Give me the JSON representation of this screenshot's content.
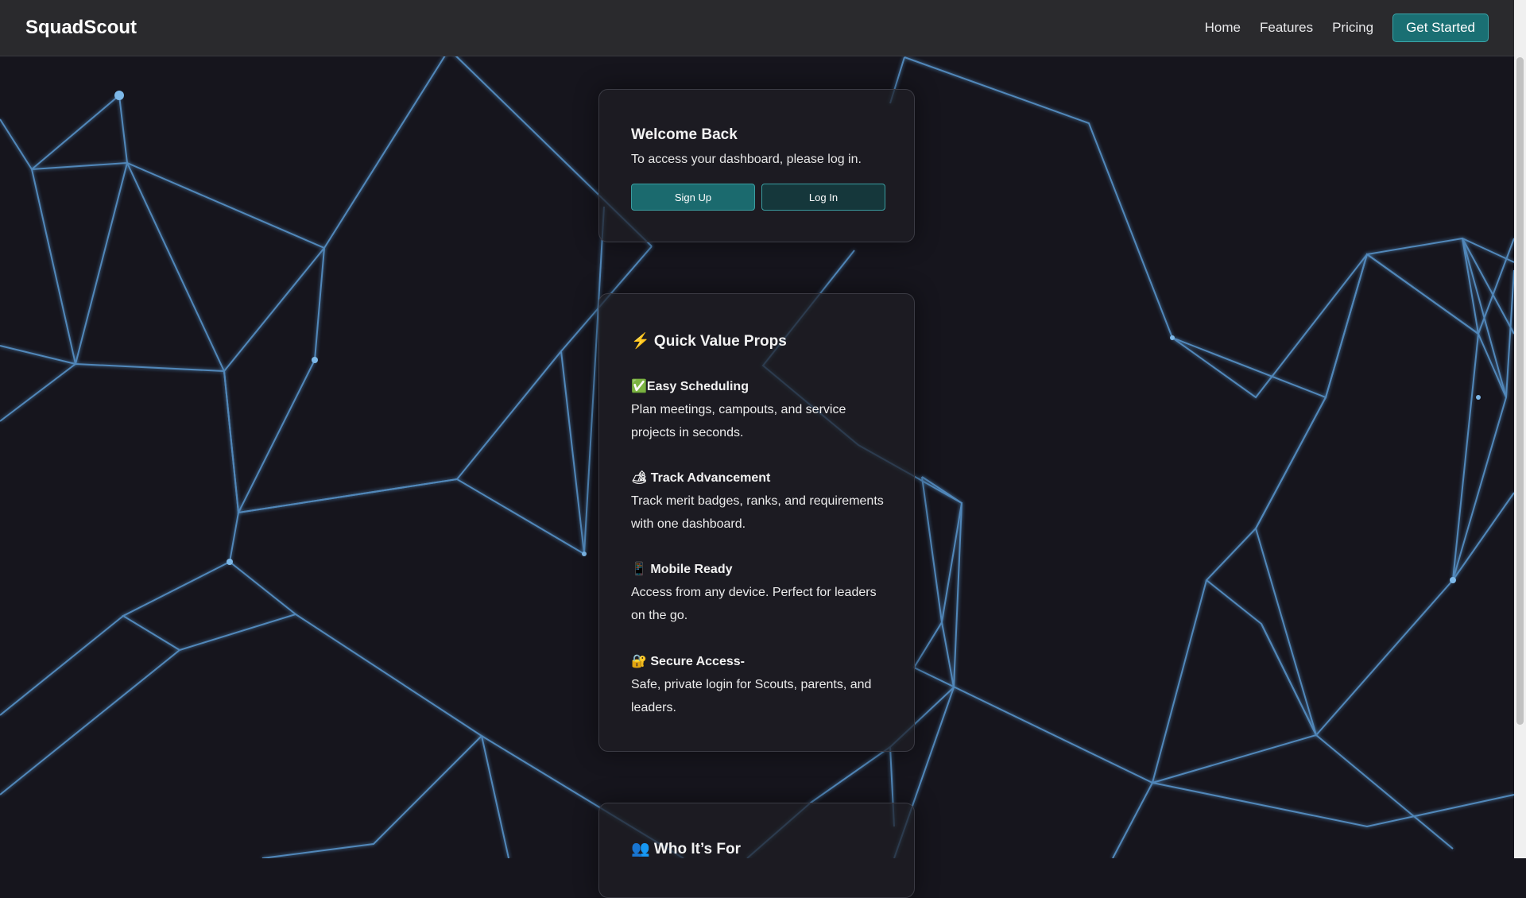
{
  "brand": "SquadScout",
  "nav": {
    "links": [
      "Home",
      "Features",
      "Pricing"
    ],
    "cta": "Get Started"
  },
  "welcome": {
    "title": "Welcome Back",
    "subtitle": "To access your dashboard, please log in.",
    "signup_label": "Sign Up",
    "login_label": "Log In"
  },
  "value_props": {
    "title": "⚡ Quick Value Props",
    "items": [
      {
        "title": "✅Easy Scheduling",
        "text": "Plan meetings, campouts, and service projects in seconds."
      },
      {
        "title": "🏕 Track Advancement",
        "text": "Track merit badges, ranks, and requirements with one dashboard."
      },
      {
        "title": "📱 Mobile Ready",
        "text": "Access from any device. Perfect for leaders on the go."
      },
      {
        "title": "🔐 Secure Access-",
        "text": "Safe, private login for Scouts, parents, and leaders."
      }
    ]
  },
  "who": {
    "title": "👥 Who It’s For"
  },
  "colors": {
    "background": "#16151d",
    "topbar": "#2a2a2d",
    "accent": "#1a6f73",
    "accent_border": "#3aa6aa",
    "network_line": "#5b9bd5"
  }
}
